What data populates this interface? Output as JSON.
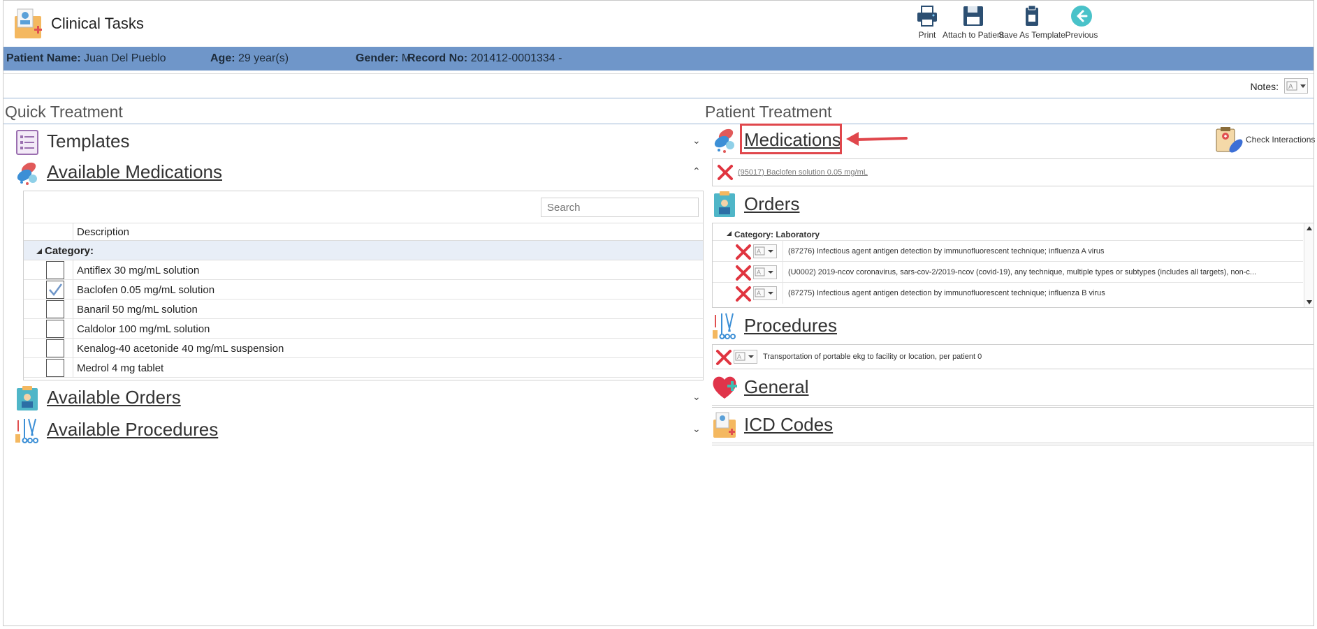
{
  "app": {
    "title": "Clinical Tasks"
  },
  "toolbar": {
    "print": "Print",
    "attach": "Attach to Patient",
    "save_template": "Save As Template",
    "previous": "Previous"
  },
  "patient": {
    "name_label": "Patient Name:",
    "name": "Juan Del Pueblo",
    "age_label": "Age:",
    "age": "29 year(s)",
    "gender_label": "Gender:",
    "gender": "M",
    "record_label": "Record No:",
    "record": "201412-0001334 -"
  },
  "notes": {
    "label": "Notes:"
  },
  "quick_treatment": {
    "title": "Quick Treatment",
    "templates": "Templates",
    "available_medications": "Available Medications",
    "search_placeholder": "Search",
    "col_description": "Description",
    "category_label": "Category:",
    "medications": [
      {
        "name": "Antiflex 30 mg/mL solution",
        "checked": false
      },
      {
        "name": "Baclofen 0.05 mg/mL solution",
        "checked": true
      },
      {
        "name": "Banaril 50 mg/mL solution",
        "checked": false
      },
      {
        "name": "Caldolor 100 mg/mL solution",
        "checked": false
      },
      {
        "name": "Kenalog-40 acetonide 40 mg/mL suspension",
        "checked": false
      },
      {
        "name": "Medrol 4 mg tablet",
        "checked": false
      }
    ],
    "available_orders": "Available Orders",
    "available_procedures": "Available Procedures"
  },
  "patient_treatment": {
    "title": "Patient Treatment",
    "medications": "Medications",
    "check_interactions": "Check Interactions",
    "medication_item": "(95017) Baclofen solution 0.05 mg/mL",
    "orders": "Orders",
    "orders_category": "Category: Laboratory",
    "order_items": [
      "(87276) Infectious agent antigen detection by immunofluorescent technique; influenza A virus",
      "(U0002) 2019-ncov coronavirus, sars-cov-2/2019-ncov (covid-19), any technique, multiple types or subtypes (includes all targets), non-c...",
      "(87275) Infectious agent antigen detection by immunofluorescent technique; influenza B virus"
    ],
    "procedures": "Procedures",
    "procedure_item": "Transportation of portable ekg to facility or location, per patient 0",
    "general": "General",
    "icd_codes": "ICD Codes"
  },
  "colors": {
    "patient_bar": "#6f96c9",
    "highlight": "#e0474c",
    "delete": "#e0343f"
  }
}
